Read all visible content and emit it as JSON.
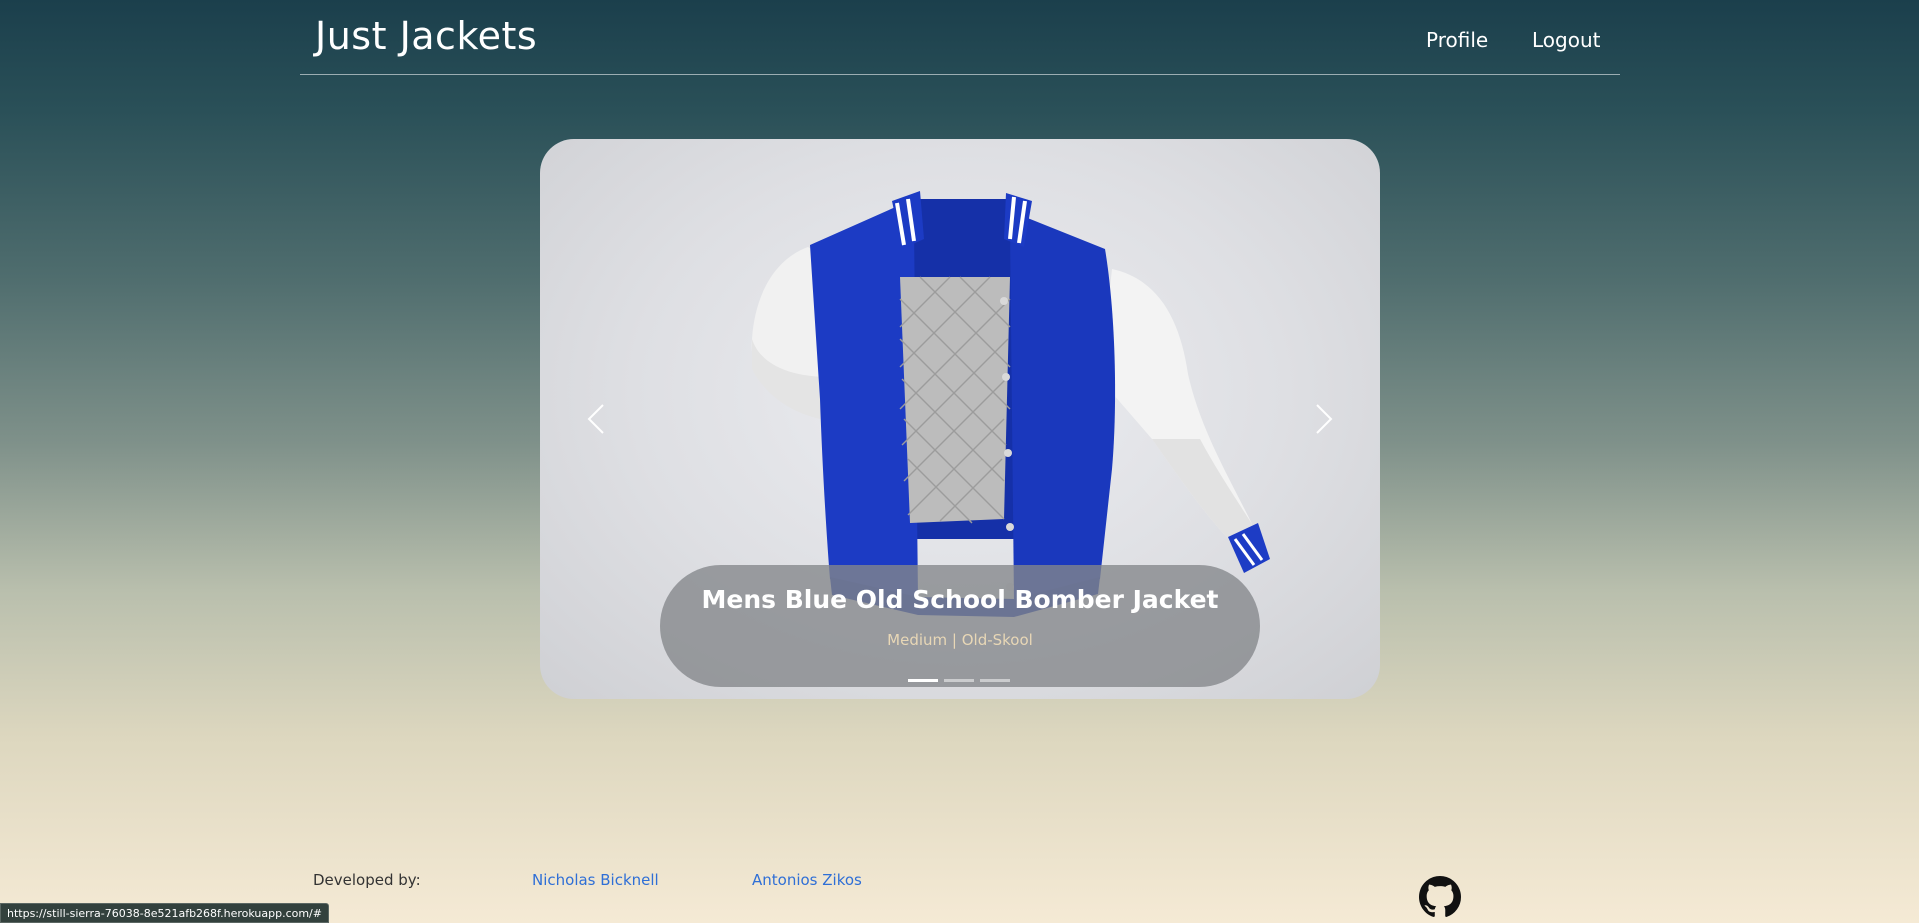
{
  "header": {
    "brand": "Just Jackets",
    "nav": {
      "profile": "Profile",
      "logout": "Logout"
    }
  },
  "carousel": {
    "active_index": 0,
    "slide_count": 3,
    "product": {
      "title": "Mens Blue Old School Bomber Jacket",
      "subtitle": "Medium | Old-Skool"
    },
    "icons": {
      "prev": "chevron-left-icon",
      "next": "chevron-right-icon"
    }
  },
  "footer": {
    "label": "Developed by:",
    "developers": [
      "Nicholas Bicknell",
      "Antonios Zikos"
    ],
    "icon": "github-icon"
  },
  "status_bar": {
    "url": "https://still-sierra-76038-8e521afb268f.herokuapp.com/#"
  },
  "colors": {
    "jacket_body": "#1c3bc4",
    "link": "#2f6fd6",
    "caption_subtitle": "#e8d7b6"
  }
}
